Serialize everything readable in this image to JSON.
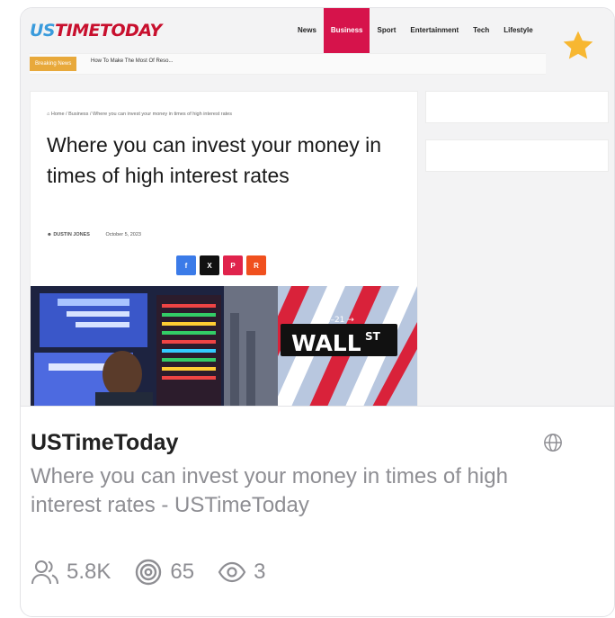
{
  "preview": {
    "logo_us": "US",
    "logo_rest": "TIMETODAY",
    "nav": [
      "News",
      "Business",
      "Sport",
      "Entertainment",
      "Tech",
      "Lifestyle"
    ],
    "ticker_badge": "Breaking News",
    "ticker_text": "How To Make The Most Of Reso...",
    "breadcrumb": "⌂ Home / Business / Where you can invest your money in times of high interest rates",
    "headline": "Where you can invest your money in times of high interest rates",
    "author": "☻ DUSTIN JONES",
    "date": "October 5, 2023",
    "share": [
      "f",
      "X",
      "P",
      "R"
    ],
    "street_sign": "WALL",
    "street_sign_suffix": "ST",
    "street_number": "11–21 →"
  },
  "card": {
    "site_name": "USTimeToday",
    "description": "Where you can invest your money in times of high interest rates - USTimeToday",
    "stats": {
      "followers": "5.8K",
      "targets": "65",
      "views": "3"
    }
  },
  "colors": {
    "star": "#f7b731",
    "accent": "#d6134b",
    "muted_text": "#8e8e93"
  }
}
